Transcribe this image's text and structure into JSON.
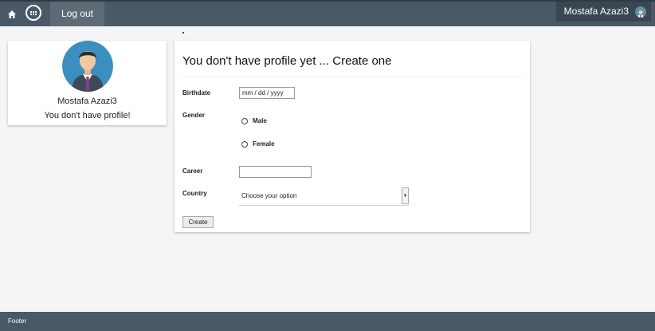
{
  "navbar": {
    "home_icon": "home-icon",
    "logo_icon": "brand-logo-icon",
    "logout_label": "Log out",
    "user_name": "Mostafa Azazi3",
    "user_avatar_icon": "user-avatar-icon",
    "colors": {
      "bar": "#4a5966",
      "active_item": "#5d6b77",
      "user_menu": "#3a4752"
    }
  },
  "profile_card": {
    "avatar_icon": "person-avatar-icon",
    "name": "Mostafa Azazi3",
    "status": "You don't have profile!"
  },
  "form": {
    "title": "You don't have profile yet ... Create one",
    "birthdate": {
      "label": "Birthdate",
      "placeholder": "mm / dd / yyyy"
    },
    "gender": {
      "label": "Gender",
      "options": [
        "Male",
        "Female"
      ],
      "selected": null
    },
    "career": {
      "label": "Career",
      "value": ""
    },
    "country": {
      "label": "Country",
      "value": "Choose your option"
    },
    "submit_label": "Create"
  },
  "footer": {
    "text": "Footer"
  }
}
